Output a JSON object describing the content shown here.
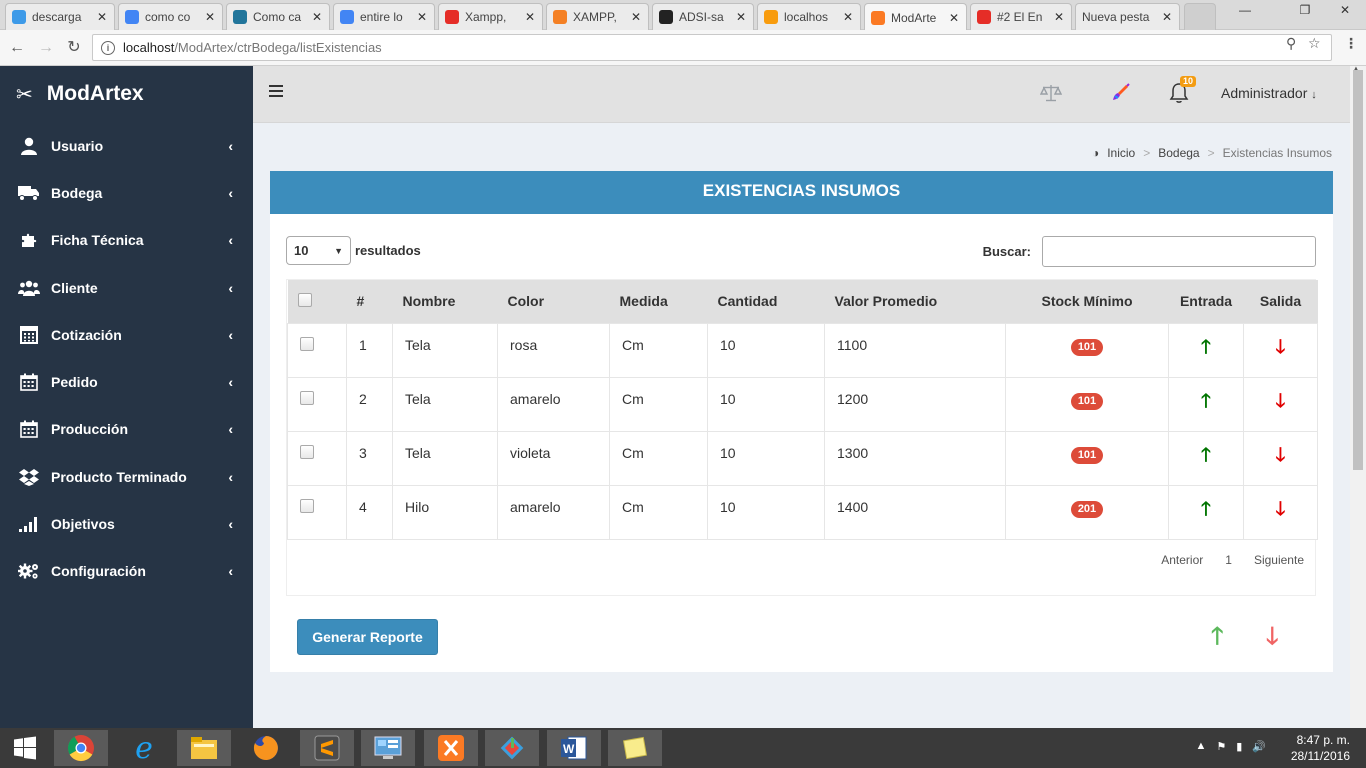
{
  "browser": {
    "tabs": [
      {
        "title": "descarga",
        "icon": "dropbox-icon",
        "color": "#3d9ae8"
      },
      {
        "title": "como co",
        "icon": "google-icon",
        "color": "#4285f4"
      },
      {
        "title": "Como ca",
        "icon": "wordpress-icon",
        "color": "#21759b"
      },
      {
        "title": "entire lo",
        "icon": "google-icon",
        "color": "#4285f4"
      },
      {
        "title": "Xampp,",
        "icon": "youtube-icon",
        "color": "#e52d27"
      },
      {
        "title": "XAMPP,",
        "icon": "stackoverflow-icon",
        "color": "#f48024"
      },
      {
        "title": "ADSI-sa",
        "icon": "github-icon",
        "color": "#222222"
      },
      {
        "title": "localhos",
        "icon": "phpmyadmin-icon",
        "color": "#f89c0e"
      },
      {
        "title": "ModArte",
        "icon": "xampp-icon",
        "color": "#fb7a24"
      },
      {
        "title": "#2 El En",
        "icon": "youtube-icon",
        "color": "#e52d27"
      },
      {
        "title": "Nueva pesta",
        "icon": "",
        "color": ""
      }
    ],
    "active_tab": 8,
    "url_host": "localhost",
    "url_path": "/ModArtex/ctrBodega/listExistencias"
  },
  "sidebar": {
    "brand": "ModArtex",
    "items": [
      {
        "label": "Usuario",
        "icon": "user-icon"
      },
      {
        "label": "Bodega",
        "icon": "truck-icon"
      },
      {
        "label": "Ficha Técnica",
        "icon": "puzzle-icon"
      },
      {
        "label": "Cliente",
        "icon": "users-icon"
      },
      {
        "label": "Cotización",
        "icon": "calculator-icon"
      },
      {
        "label": "Pedido",
        "icon": "calendar-icon"
      },
      {
        "label": "Producción",
        "icon": "calendar-icon"
      },
      {
        "label": "Producto Terminado",
        "icon": "dropbox-icon"
      },
      {
        "label": "Objetivos",
        "icon": "signal-icon"
      },
      {
        "label": "Configuración",
        "icon": "gears-icon"
      }
    ]
  },
  "topnav": {
    "notifications_count": "10",
    "user_name": "Administrador"
  },
  "breadcrumb": [
    "Inicio",
    "Bodega",
    "Existencias Insumos"
  ],
  "box": {
    "title": "EXISTENCIAS INSUMOS",
    "length_value": "10",
    "length_label": "resultados",
    "search_label": "Buscar:",
    "search_value": "",
    "columns": [
      "#",
      "Nombre",
      "Color",
      "Medida",
      "Cantidad",
      "Valor Promedio",
      "Stock Mínimo",
      "Entrada",
      "Salida"
    ],
    "rows": [
      {
        "num": "1",
        "nombre": "Tela",
        "color": "rosa",
        "medida": "Cm",
        "cantidad": "10",
        "valor": "1100",
        "stock": "101"
      },
      {
        "num": "2",
        "nombre": "Tela",
        "color": "amarelo",
        "medida": "Cm",
        "cantidad": "10",
        "valor": "1200",
        "stock": "101"
      },
      {
        "num": "3",
        "nombre": "Tela",
        "color": "violeta",
        "medida": "Cm",
        "cantidad": "10",
        "valor": "1300",
        "stock": "101"
      },
      {
        "num": "4",
        "nombre": "Hilo",
        "color": "amarelo",
        "medida": "Cm",
        "cantidad": "10",
        "valor": "1400",
        "stock": "201"
      }
    ],
    "pager": {
      "prev": "Anterior",
      "page": "1",
      "next": "Siguiente"
    },
    "report_button": "Generar Reporte"
  },
  "taskbar": {
    "apps": [
      "chrome-icon",
      "ie-icon",
      "file-explorer-icon",
      "firefox-icon",
      "sublime-icon",
      "control-panel-icon",
      "xampp-icon",
      "git-icon",
      "word-icon",
      "sticky-notes-icon"
    ],
    "time": "8:47 p. m.",
    "date": "28/11/2016"
  },
  "colors": {
    "sidebar_bg": "#263445",
    "header_blue": "#3c8dbc",
    "badge_red": "#dd4b39",
    "arrow_up": "#007400",
    "arrow_down": "#e00000",
    "notif_badge": "#f39c12"
  }
}
